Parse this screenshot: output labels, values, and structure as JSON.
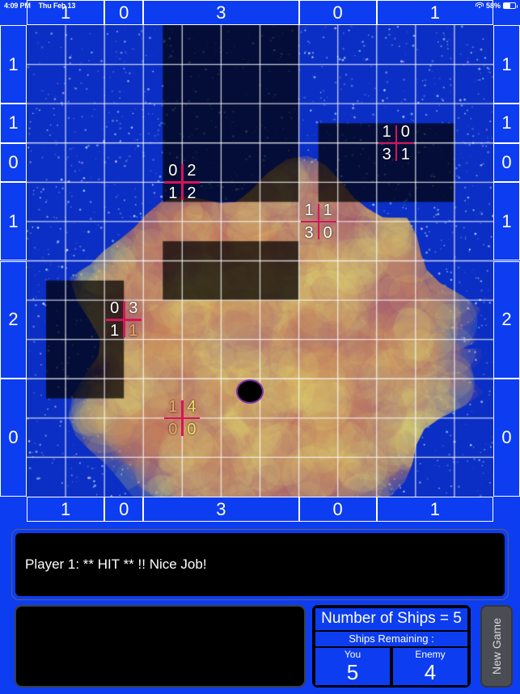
{
  "status_bar": {
    "time": "4:09 PM",
    "date": "Thu Feb 13",
    "wifi_icon": "wifi-icon",
    "battery_text": "58%",
    "battery_icon": "battery-icon",
    "battery_percent": 58
  },
  "board": {
    "columns": 12,
    "rows": 12,
    "top_headers": [
      "1",
      "0",
      "3",
      "0",
      "1"
    ],
    "bottom_headers": [
      "1",
      "0",
      "3",
      "0",
      "1"
    ],
    "left_headers": [
      "1",
      "1",
      "0",
      "1",
      "2",
      "0"
    ],
    "right_headers": [
      "1",
      "1",
      "0",
      "1",
      "2",
      "0"
    ],
    "crosshairs": [
      {
        "name": "crosshair-a",
        "col": 4,
        "row": 4,
        "tl": "0",
        "tr": "2",
        "bl": "1",
        "br": "2",
        "style": "white"
      },
      {
        "name": "crosshair-b",
        "col": 9.5,
        "row": 3,
        "tl": "1",
        "tr": "0",
        "bl": "3",
        "br": "1",
        "style": "white"
      },
      {
        "name": "crosshair-c",
        "col": 7.5,
        "row": 5,
        "tl": "1",
        "tr": "1",
        "bl": "3",
        "br": "0",
        "style": "white"
      },
      {
        "name": "crosshair-d",
        "col": 2.5,
        "row": 7.5,
        "tl": "0",
        "tr": "3",
        "bl": "1",
        "br": "1",
        "style": "mixed"
      },
      {
        "name": "crosshair-e",
        "col": 4,
        "row": 10,
        "tl": "1",
        "tr": "4",
        "bl": "0",
        "br": "0",
        "style": "tan"
      }
    ]
  },
  "message": {
    "text": "Player 1: ** HIT ** !!   Nice Job!"
  },
  "log_panel": {
    "text": ""
  },
  "ships_panel": {
    "title": "Number of Ships = 5",
    "subtitle": "Ships Remaining :",
    "you_label": "You",
    "you_value": "5",
    "enemy_label": "Enemy",
    "enemy_value": "4"
  },
  "new_game_button": {
    "label": "New Game"
  },
  "colors": {
    "background_blue": "#0d3df0",
    "crosshair_red": "#d4145a",
    "panel_black": "#000000",
    "button_gray": "#4a4d53"
  }
}
